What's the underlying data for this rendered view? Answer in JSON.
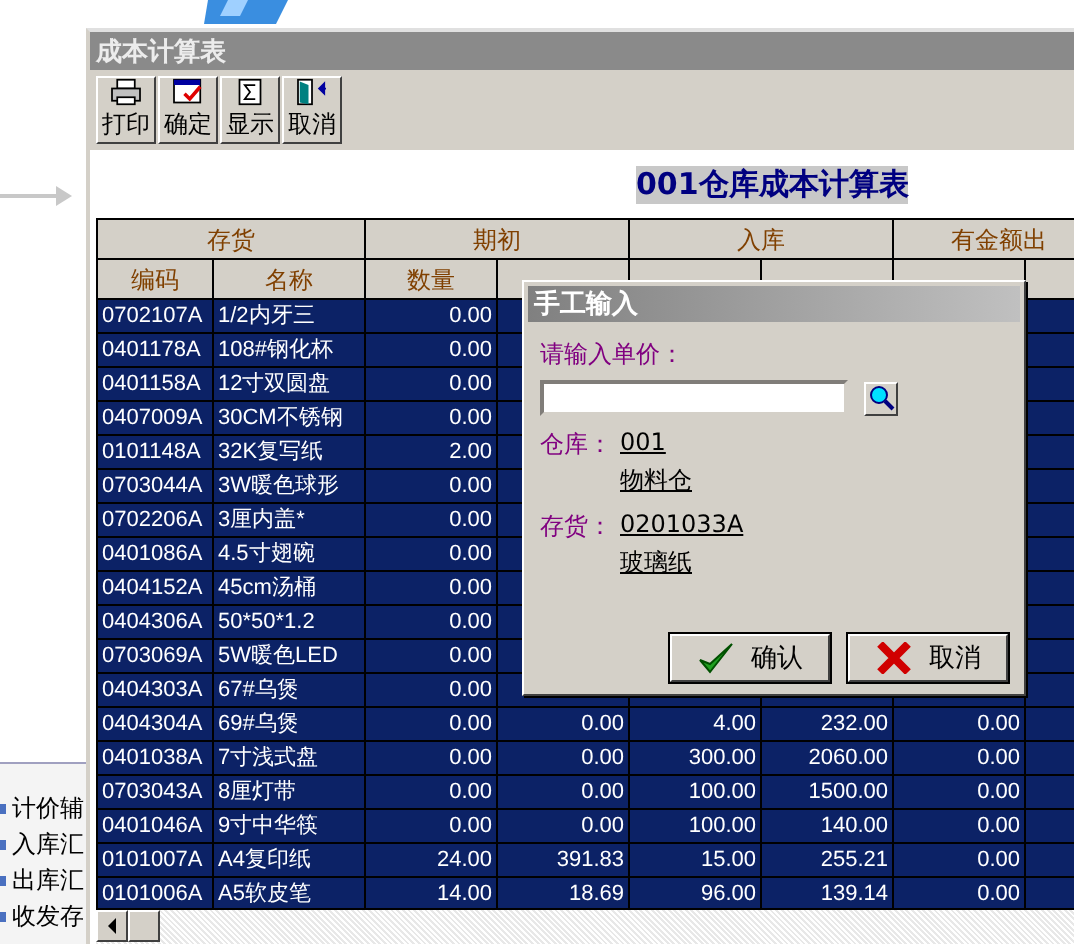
{
  "side_panel": {
    "items": [
      "计价辅",
      "入库汇",
      "出库汇",
      "收发存"
    ]
  },
  "window": {
    "title": "成本计算表"
  },
  "toolbar": [
    {
      "kind": "print",
      "label": "打印"
    },
    {
      "kind": "confirm",
      "label": "确定"
    },
    {
      "kind": "sum",
      "label": "显示"
    },
    {
      "kind": "exit",
      "label": "取消"
    }
  ],
  "report_title": "001仓库成本计算表",
  "table": {
    "groups": [
      {
        "label": "存货"
      },
      {
        "label": "期初"
      },
      {
        "label": "入库"
      },
      {
        "label": "有金额出"
      }
    ],
    "columns": [
      "编码",
      "名称",
      "数量"
    ],
    "rows": [
      {
        "cells": [
          "0702107A",
          "1/2内牙三",
          "0.00"
        ]
      },
      {
        "cells": [
          "0401178A",
          "108#钢化杯",
          "0.00"
        ]
      },
      {
        "cells": [
          "0401158A",
          "12寸双圆盘",
          "0.00"
        ]
      },
      {
        "cells": [
          "0407009A",
          "30CM不锈钢",
          "0.00"
        ]
      },
      {
        "cells": [
          "0101148A",
          "32K复写纸",
          "2.00"
        ]
      },
      {
        "cells": [
          "0703044A",
          "3W暖色球形",
          "0.00"
        ]
      },
      {
        "cells": [
          "0702206A",
          "3厘内盖*",
          "0.00"
        ]
      },
      {
        "cells": [
          "0401086A",
          "4.5寸翅碗",
          "0.00"
        ]
      },
      {
        "cells": [
          "0404152A",
          "45cm汤桶",
          "0.00"
        ]
      },
      {
        "cells": [
          "0404306A",
          "50*50*1.2",
          "0.00"
        ]
      },
      {
        "cells": [
          "0703069A",
          "5W暖色LED",
          "0.00"
        ]
      },
      {
        "cells": [
          "0404303A",
          "67#乌煲",
          "0.00"
        ]
      },
      {
        "cells": [
          "0404304A",
          "69#乌煲",
          "0.00",
          "0.00",
          "4.00",
          "232.00",
          "0.00"
        ]
      },
      {
        "cells": [
          "0401038A",
          "7寸浅式盘",
          "0.00",
          "0.00",
          "300.00",
          "2060.00",
          "0.00"
        ]
      },
      {
        "cells": [
          "0703043A",
          "8厘灯带",
          "0.00",
          "0.00",
          "100.00",
          "1500.00",
          "0.00"
        ]
      },
      {
        "cells": [
          "0401046A",
          "9寸中华筷",
          "0.00",
          "0.00",
          "100.00",
          "140.00",
          "0.00"
        ]
      },
      {
        "cells": [
          "0101007A",
          "A4复印纸",
          "24.00",
          "391.83",
          "15.00",
          "255.21",
          "0.00"
        ]
      },
      {
        "cells": [
          "0101006A",
          "A5软皮笔",
          "14.00",
          "18.69",
          "96.00",
          "139.14",
          "0.00"
        ]
      }
    ]
  },
  "dialog": {
    "title": "手工输入",
    "prompt": "请输入单价：",
    "warehouse_label": "仓库：",
    "warehouse_code": "001",
    "warehouse_name": "物料仓",
    "item_label": "存货：",
    "item_code": "0201033A",
    "item_name": "玻璃纸",
    "buttons": [
      {
        "kind": "ok",
        "label": "确认"
      },
      {
        "kind": "cancel",
        "label": "取消"
      }
    ]
  }
}
